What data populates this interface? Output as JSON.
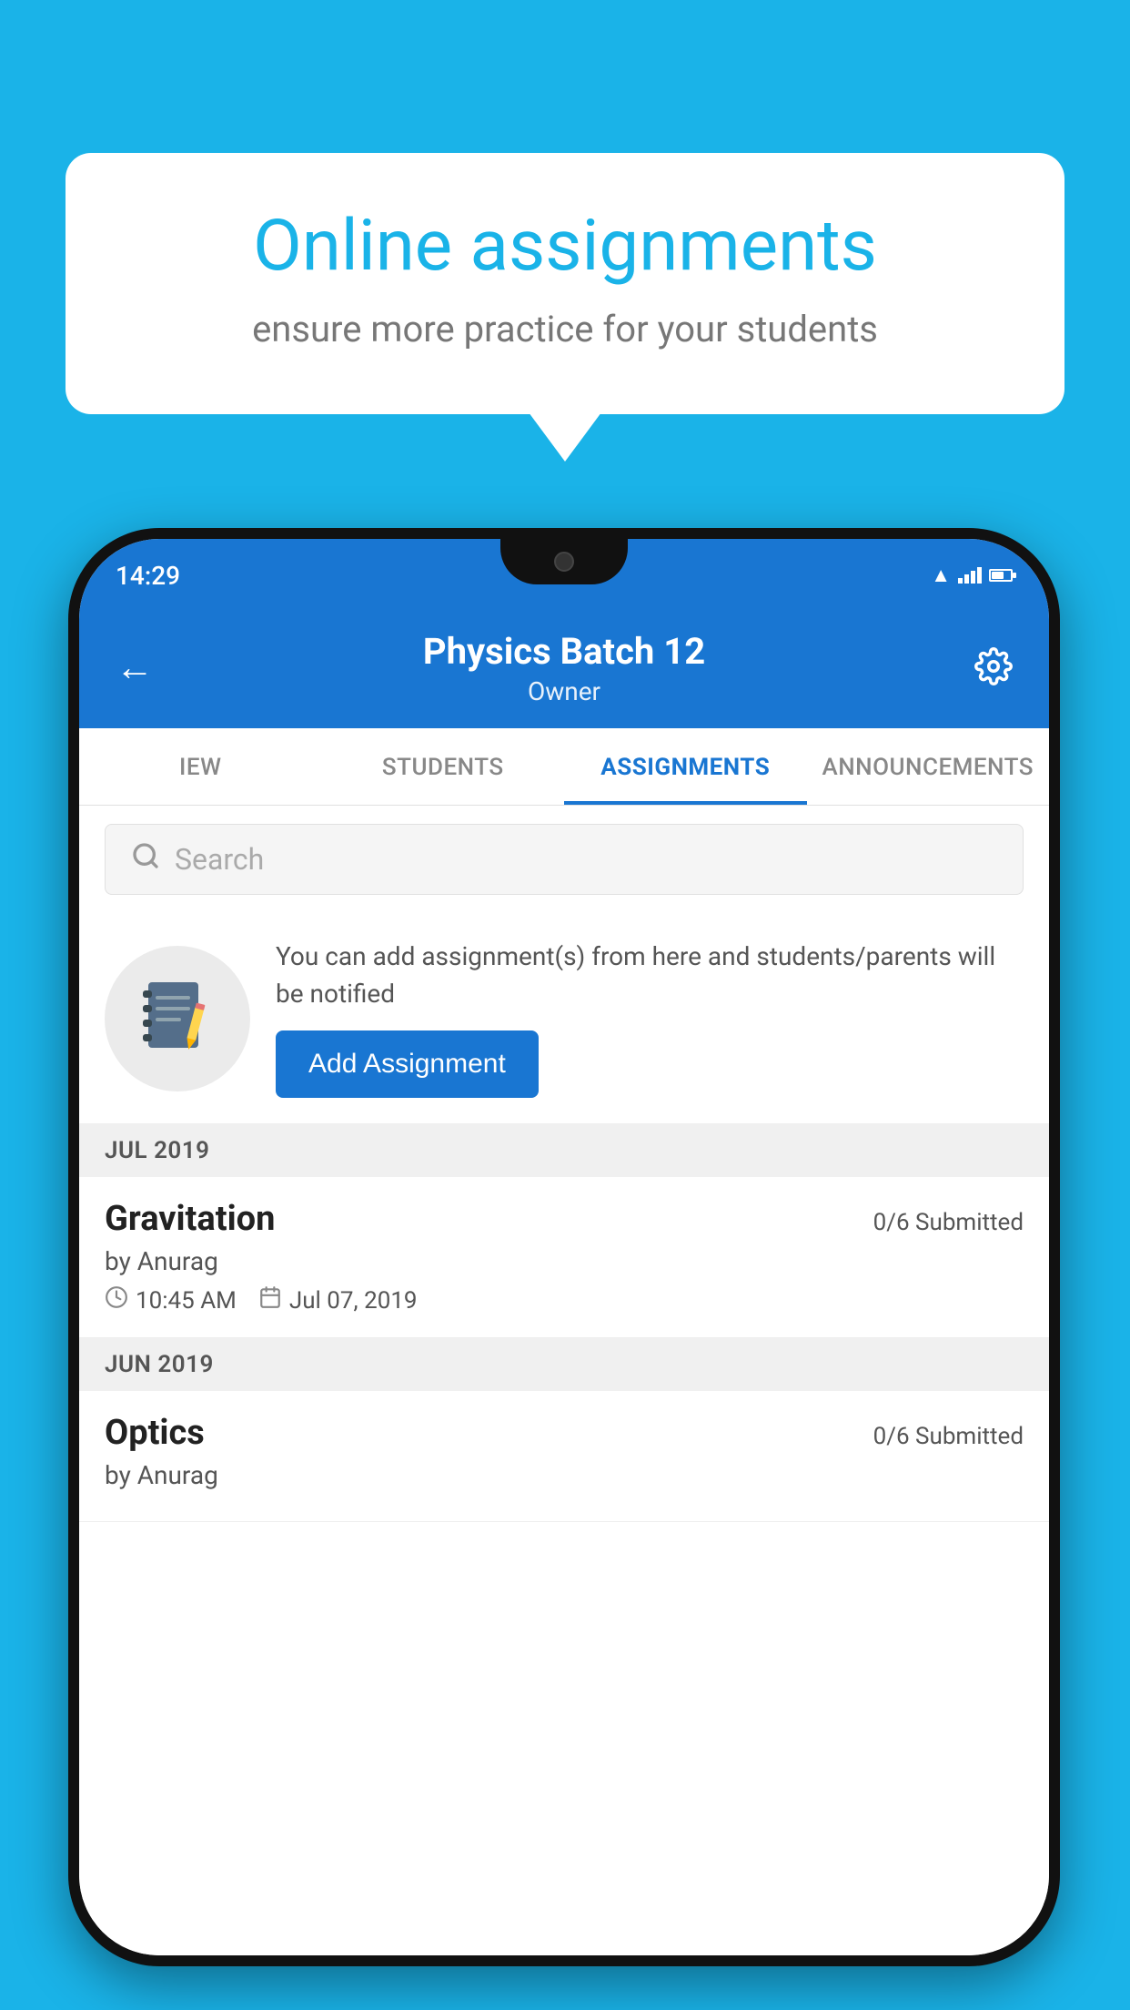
{
  "background_color": "#1ab3e8",
  "bubble": {
    "title": "Online assignments",
    "subtitle": "ensure more practice for your students"
  },
  "phone": {
    "status_bar": {
      "time": "14:29",
      "wifi_icon": "wifi",
      "signal_icon": "signal",
      "battery_icon": "battery"
    },
    "header": {
      "title": "Physics Batch 12",
      "subtitle": "Owner",
      "back_label": "back",
      "settings_label": "settings"
    },
    "tabs": [
      {
        "label": "IEW",
        "active": false
      },
      {
        "label": "STUDENTS",
        "active": false
      },
      {
        "label": "ASSIGNMENTS",
        "active": true
      },
      {
        "label": "ANNOUNCEMENTS",
        "active": false
      }
    ],
    "search": {
      "placeholder": "Search"
    },
    "promo": {
      "description": "You can add assignment(s) from here and students/parents will be notified",
      "button_label": "Add Assignment"
    },
    "sections": [
      {
        "month_label": "JUL 2019",
        "assignments": [
          {
            "name": "Gravitation",
            "submitted": "0/6 Submitted",
            "by": "by Anurag",
            "time": "10:45 AM",
            "date": "Jul 07, 2019"
          }
        ]
      },
      {
        "month_label": "JUN 2019",
        "assignments": [
          {
            "name": "Optics",
            "submitted": "0/6 Submitted",
            "by": "by Anurag",
            "time": "",
            "date": ""
          }
        ]
      }
    ]
  }
}
